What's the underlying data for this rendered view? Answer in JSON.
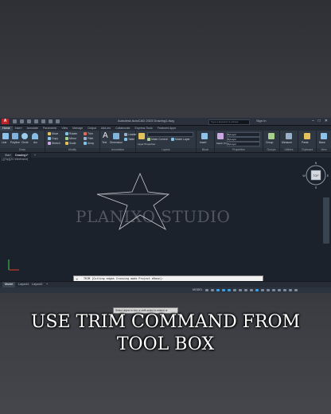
{
  "app": {
    "logo_text": "A",
    "title": "Autodesk AutoCAD 2023   Drawing1.dwg",
    "search_placeholder": "Type a keyword or phrase",
    "signin": "Sign In",
    "window_controls": [
      "–",
      "□",
      "✕"
    ]
  },
  "ribbon_tabs": [
    "Home",
    "Insert",
    "Annotate",
    "Parametric",
    "View",
    "Manage",
    "Output",
    "Add-ins",
    "Collaborate",
    "Express Tools",
    "Featured Apps"
  ],
  "active_ribbon_tab": "Home",
  "panels": {
    "draw": {
      "title": "Draw",
      "buttons": [
        "Line",
        "Polyline",
        "Circle",
        "Arc"
      ]
    },
    "modify": {
      "title": "Modify",
      "buttons": [
        "Move",
        "Rotate",
        "Trim",
        "Copy",
        "Mirror",
        "Fillet",
        "Stretch",
        "Scale",
        "Array"
      ]
    },
    "annotation": {
      "title": "Annotation",
      "buttons": [
        "Text",
        "Dimension",
        "Leader",
        "Table"
      ]
    },
    "layers": {
      "title": "Layers",
      "buttons": [
        "Layer Properties",
        "Make Current",
        "Match Layer"
      ]
    },
    "block": {
      "title": "Block",
      "buttons": [
        "Insert"
      ]
    },
    "properties": {
      "title": "Properties",
      "buttons": [
        "Match Properties",
        "ByLayer",
        "ByLayer",
        "ByLayer"
      ]
    },
    "groups": {
      "title": "Groups",
      "buttons": [
        "Group"
      ]
    },
    "utilities": {
      "title": "Utilities",
      "buttons": [
        "Measure"
      ]
    },
    "clipboard": {
      "title": "Clipboard",
      "buttons": [
        "Paste"
      ]
    },
    "view": {
      "title": "View",
      "buttons": [
        "Base"
      ]
    }
  },
  "file_tabs": [
    "Start",
    "Drawing1*",
    "+"
  ],
  "viewport_label": "[-][Top][2D Wireframe]",
  "tooltip_text": "Select object to trim or shift-select to extend or",
  "watermark": "PLANIXO STUDIO",
  "viewcube": {
    "top_label": "N",
    "face": "TOP",
    "bottom_label": "S",
    "left_label": "W",
    "right_label": "E"
  },
  "command_line": {
    "close": "✕",
    "text": "TRIM [Cutting edges Crossing mode Project eRase]:"
  },
  "layout_tabs": [
    "Model",
    "Layout1",
    "Layout2",
    "+"
  ],
  "status": {
    "model": "MODEL"
  },
  "caption": {
    "line1": "USE TRIM COMMAND FROM",
    "line2": "TOOL BOX"
  },
  "colors": {
    "accent": "#3aa0e8",
    "drawing_area": "#1c222c",
    "ucs_x": "#c0392b",
    "ucs_y": "#3bb54a"
  }
}
